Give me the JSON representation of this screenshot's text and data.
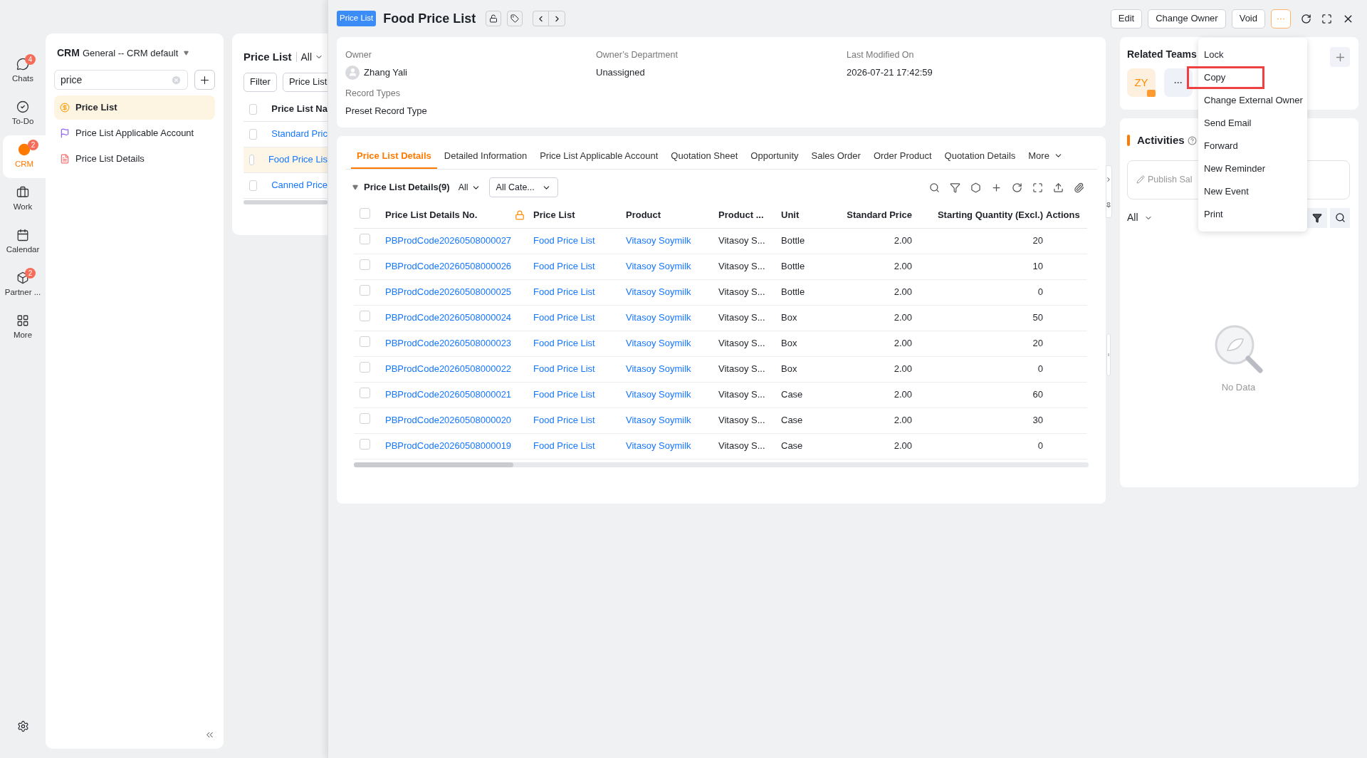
{
  "rail": [
    {
      "kind": "chat",
      "label": "Chats",
      "badge": "4",
      "selected": false
    },
    {
      "kind": "todo",
      "label": "To-Do",
      "selected": false
    },
    {
      "kind": "crm",
      "label": "CRM",
      "badge": "2",
      "selected": true
    },
    {
      "kind": "work",
      "label": "Work",
      "selected": false
    },
    {
      "kind": "calendar",
      "label": "Calendar",
      "selected": false
    },
    {
      "kind": "partner",
      "label": "Partner ...",
      "badge": "2",
      "selected": false
    },
    {
      "kind": "more",
      "label": "More",
      "selected": false
    }
  ],
  "nav": {
    "app": "CRM",
    "workspace": "General -- CRM default",
    "search": "price",
    "items": [
      {
        "kind": "money",
        "label": "Price List",
        "selected": true
      },
      {
        "kind": "flag",
        "label": "Price List Applicable Account",
        "selected": false
      },
      {
        "kind": "doc",
        "label": "Price List Details",
        "selected": false
      }
    ]
  },
  "list": {
    "title": "Price List",
    "scope": "All",
    "filters": [
      "Filter",
      "Price List"
    ],
    "column": "Price List Na",
    "all_checked": false,
    "rows": [
      {
        "name": "Standard Pric",
        "selected": false,
        "checked": false
      },
      {
        "name": "Food Price Lis",
        "selected": true,
        "checked": false
      },
      {
        "name": "Canned Price",
        "selected": false,
        "checked": false
      }
    ]
  },
  "header": {
    "tag": "Price List",
    "title": "Food Price List",
    "buttons": [
      "Edit",
      "Change Owner",
      "Void"
    ],
    "more": "···"
  },
  "info": [
    {
      "label": "Owner",
      "value": "Zhang Yali",
      "avatar": true
    },
    {
      "label": "Owner’s Department",
      "value": "Unassigned",
      "avatar": false
    },
    {
      "label": "Last Modified On",
      "value": "2026-07-21 17:42:59",
      "avatar": false
    },
    {
      "label": "Record Types",
      "value": "Preset Record Type",
      "avatar": false
    }
  ],
  "tabs": [
    {
      "label": "Price List Details",
      "selected": true
    },
    {
      "label": "Detailed Information",
      "selected": false
    },
    {
      "label": "Price List Applicable Account",
      "selected": false
    },
    {
      "label": "Quotation Sheet",
      "selected": false
    },
    {
      "label": "Opportunity",
      "selected": false
    },
    {
      "label": "Sales Order",
      "selected": false
    },
    {
      "label": "Order Product",
      "selected": false
    },
    {
      "label": "Quotation Details",
      "selected": false
    },
    {
      "label": "More",
      "selected": false
    }
  ],
  "details": {
    "title": "Price List Details(9)",
    "scope": "All",
    "category": "All Cate...",
    "all_checked": false,
    "columns": [
      "Price List Details No.",
      "Price List",
      "Product",
      "Product ...",
      "Unit",
      "Standard Price",
      "Starting Quantity (Excl.)",
      "Actions"
    ],
    "rows": [
      {
        "checked": false,
        "no": "PBProdCode20260508000027",
        "price_list": "Food Price List",
        "product": "Vitasoy Soymilk",
        "product_2": "Vitasoy S...",
        "unit": "Bottle",
        "standard_price": "2.00",
        "starting_quantity": "20"
      },
      {
        "checked": false,
        "no": "PBProdCode20260508000026",
        "price_list": "Food Price List",
        "product": "Vitasoy Soymilk",
        "product_2": "Vitasoy S...",
        "unit": "Bottle",
        "standard_price": "2.00",
        "starting_quantity": "10"
      },
      {
        "checked": false,
        "no": "PBProdCode20260508000025",
        "price_list": "Food Price List",
        "product": "Vitasoy Soymilk",
        "product_2": "Vitasoy S...",
        "unit": "Bottle",
        "standard_price": "2.00",
        "starting_quantity": "0"
      },
      {
        "checked": false,
        "no": "PBProdCode20260508000024",
        "price_list": "Food Price List",
        "product": "Vitasoy Soymilk",
        "product_2": "Vitasoy S...",
        "unit": "Box",
        "standard_price": "2.00",
        "starting_quantity": "50"
      },
      {
        "checked": false,
        "no": "PBProdCode20260508000023",
        "price_list": "Food Price List",
        "product": "Vitasoy Soymilk",
        "product_2": "Vitasoy S...",
        "unit": "Box",
        "standard_price": "2.00",
        "starting_quantity": "20"
      },
      {
        "checked": false,
        "no": "PBProdCode20260508000022",
        "price_list": "Food Price List",
        "product": "Vitasoy Soymilk",
        "product_2": "Vitasoy S...",
        "unit": "Box",
        "standard_price": "2.00",
        "starting_quantity": "0"
      },
      {
        "checked": false,
        "no": "PBProdCode20260508000021",
        "price_list": "Food Price List",
        "product": "Vitasoy Soymilk",
        "product_2": "Vitasoy S...",
        "unit": "Case",
        "standard_price": "2.00",
        "starting_quantity": "60"
      },
      {
        "checked": false,
        "no": "PBProdCode20260508000020",
        "price_list": "Food Price List",
        "product": "Vitasoy Soymilk",
        "product_2": "Vitasoy S...",
        "unit": "Case",
        "standard_price": "2.00",
        "starting_quantity": "30"
      },
      {
        "checked": false,
        "no": "PBProdCode20260508000019",
        "price_list": "Food Price List",
        "product": "Vitasoy Soymilk",
        "product_2": "Vitasoy S...",
        "unit": "Case",
        "standard_price": "2.00",
        "starting_quantity": "0"
      }
    ]
  },
  "teams": {
    "title": "Related Teams",
    "member": "ZY",
    "more": "···"
  },
  "activities": {
    "title": "Activities",
    "publish": "Publish Sal",
    "scope": "All",
    "empty": "No Data"
  },
  "menu": [
    {
      "label": "Lock",
      "selected": false
    },
    {
      "label": "Copy",
      "selected": true
    },
    {
      "label": "Change External Owner",
      "selected": false
    },
    {
      "label": "Send Email",
      "selected": false
    },
    {
      "label": "Forward",
      "selected": false
    },
    {
      "label": "New Reminder",
      "selected": false
    },
    {
      "label": "New Event",
      "selected": false
    },
    {
      "label": "Print",
      "selected": false
    }
  ]
}
